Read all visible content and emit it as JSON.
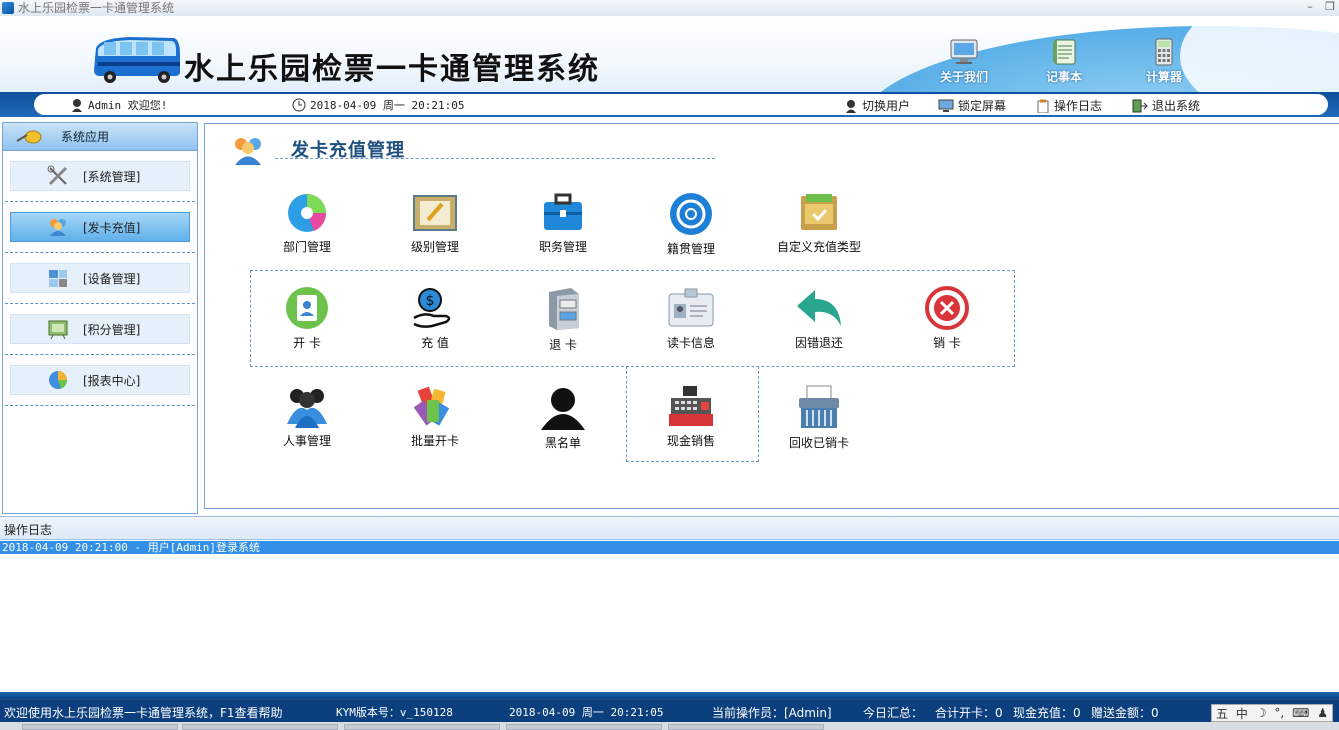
{
  "window": {
    "title": "水上乐园检票一卡通管理系统",
    "minimize": "–",
    "restore": "❐"
  },
  "header": {
    "app_name": "水上乐园检票一卡通管理系统",
    "buttons": [
      "关于我们",
      "记事本",
      "计算器"
    ]
  },
  "infobar": {
    "user": "Admin 欢迎您!",
    "datetime": "2018-04-09 周一 20:21:05",
    "actions": [
      "切换用户",
      "锁定屏幕",
      "操作日志",
      "退出系统"
    ]
  },
  "sidebar": {
    "title": "系统应用",
    "items": [
      {
        "label": "[系统管理]",
        "active": false
      },
      {
        "label": "[发卡充值]",
        "active": true
      },
      {
        "label": "[设备管理]",
        "active": false
      },
      {
        "label": "[积分管理]",
        "active": false
      },
      {
        "label": "[报表中心]",
        "active": false
      }
    ]
  },
  "main": {
    "title": "发卡充值管理",
    "row1": [
      "部门管理",
      "级别管理",
      "职务管理",
      "籍贯管理",
      "自定义充值类型"
    ],
    "row2": [
      "开 卡",
      "充 值",
      "退 卡",
      "读卡信息",
      "因错退还",
      "销 卡"
    ],
    "row3": [
      "人事管理",
      "批量开卡",
      "黑名单",
      "现金销售",
      "回收已销卡"
    ]
  },
  "log": {
    "header": "操作日志",
    "entries": [
      "2018-04-09 20:21:00 - 用户[Admin]登录系统"
    ]
  },
  "statusbar": {
    "welcome": "欢迎使用水上乐园检票一卡通管理系统，F1查看帮助",
    "version": "KYM版本号：v_150128",
    "datetime": "2018-04-09 周一 20:21:05",
    "operator": "当前操作员：[Admin]",
    "summary": "今日汇总：",
    "total_cards": "合计开卡：0",
    "cash_recharge": "现金充值：0",
    "gift_amount": "赠送金额：0",
    "ime": [
      "五",
      "中",
      "☽",
      "°,",
      "⌨",
      "♟"
    ]
  },
  "colors": {
    "banner_blue": "#0d4f9c",
    "active_item": "#5fb0ea",
    "log_highlight": "#3390e6"
  }
}
